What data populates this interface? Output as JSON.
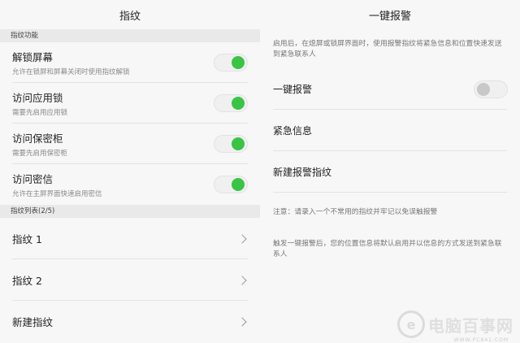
{
  "left": {
    "title": "指纹",
    "section_functions": "指纹功能",
    "toggles": [
      {
        "title": "解锁屏幕",
        "sub": "允许在锁屏和屏幕关闭时使用指纹解锁",
        "on": true
      },
      {
        "title": "访问应用锁",
        "sub": "需要先启用应用锁",
        "on": true
      },
      {
        "title": "访问保密柜",
        "sub": "需要先启用保密柜",
        "on": true
      },
      {
        "title": "访问密信",
        "sub": "允许在主屏界面快速启用密信",
        "on": true
      }
    ],
    "section_list": "指纹列表(2/5)",
    "list": [
      {
        "title": "指纹 1"
      },
      {
        "title": "指纹 2"
      },
      {
        "title": "新建指纹"
      }
    ]
  },
  "right": {
    "title": "一键报警",
    "description": "启用后，在熄屏或锁屏界面时，使用报警指纹将紧急信息和位置快速发送到紧急联系人",
    "alarm_toggle_label": "一键报警",
    "alarm_toggle_on": false,
    "emergency_info_label": "紧急信息",
    "new_alarm_fingerprint_label": "新建报警指纹",
    "note1": "注意：请录入一个不常用的指纹并牢记以免误触报警",
    "note2": "触发一键报警后，您的位置信息将默认启用并以信息的方式发送到紧急联系人"
  },
  "watermark": {
    "text": "电脑百事网",
    "sub": "WWW.PC841.COM"
  },
  "colors": {
    "accent": "#39c446",
    "off_knob": "#c8c8c8"
  }
}
